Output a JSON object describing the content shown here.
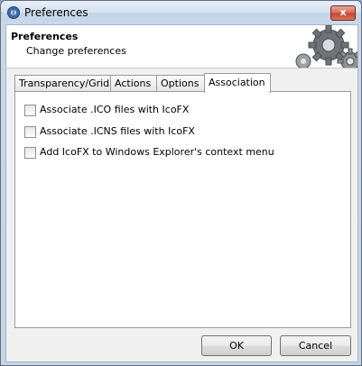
{
  "window": {
    "title": "Preferences",
    "close_glyph": "x"
  },
  "header": {
    "title": "Preferences",
    "subtitle": "Change preferences",
    "graphic": "gears-icon"
  },
  "tabs": [
    {
      "label": "Transparency/Grid",
      "active": false
    },
    {
      "label": "Actions",
      "active": false
    },
    {
      "label": "Options",
      "active": false
    },
    {
      "label": "Association",
      "active": true
    }
  ],
  "options": [
    {
      "label": "Associate .ICO files with IcoFX",
      "checked": false
    },
    {
      "label": "Associate .ICNS files with IcoFX",
      "checked": false
    },
    {
      "label": "Add IcoFX to Windows Explorer's context menu",
      "checked": false
    }
  ],
  "buttons": {
    "ok_label": "OK",
    "cancel_label": "Cancel"
  },
  "colors": {
    "close_button": "#c4422c",
    "title_bar": "#c8d8ea"
  }
}
